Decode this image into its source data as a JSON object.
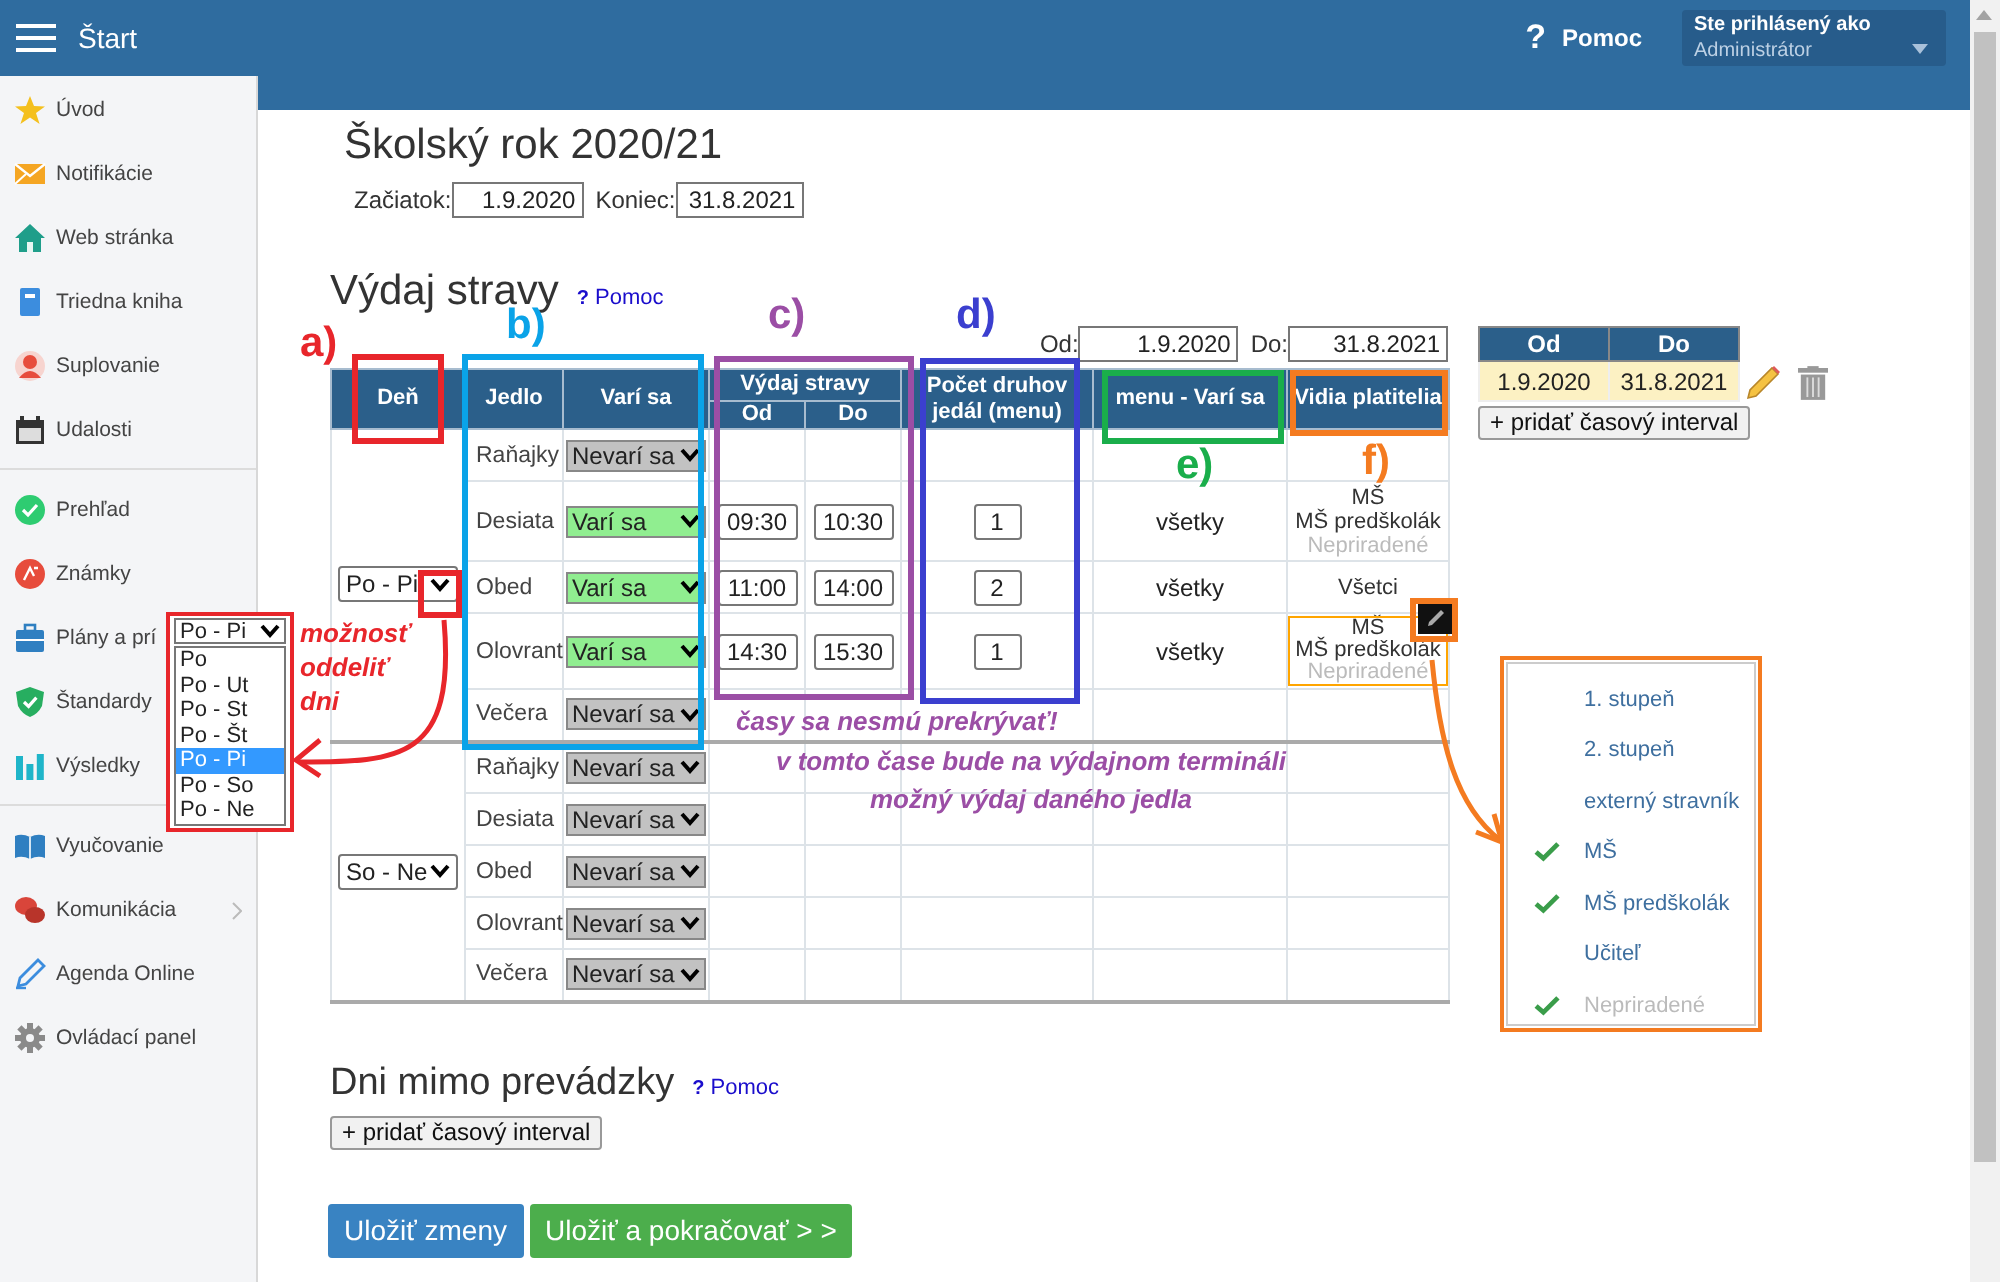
{
  "header": {
    "title": "Štart",
    "help_icon": "?",
    "help": "Pomoc",
    "user_label": "Ste prihlásený ako",
    "user_role": "Administrátor"
  },
  "sidebar": {
    "groups": [
      [
        {
          "label": "Úvod",
          "submenu": false
        },
        {
          "label": "Notifikácie",
          "submenu": false
        },
        {
          "label": "Web stránka",
          "submenu": false
        },
        {
          "label": "Triedna kniha",
          "submenu": false
        },
        {
          "label": "Suplovanie",
          "submenu": false
        },
        {
          "label": "Udalosti",
          "submenu": false
        }
      ],
      [
        {
          "label": "Prehľad",
          "submenu": false
        },
        {
          "label": "Známky",
          "submenu": false
        },
        {
          "label": "Plány a prí",
          "submenu": false
        },
        {
          "label": "Štandardy",
          "submenu": false
        },
        {
          "label": "Výsledky",
          "submenu": false
        }
      ],
      [
        {
          "label": "Vyučovanie",
          "submenu": false
        },
        {
          "label": "Komunikácia",
          "submenu": true
        },
        {
          "label": "Agenda Online",
          "submenu": false
        },
        {
          "label": "Ovládací panel",
          "submenu": false
        }
      ]
    ]
  },
  "school_year": {
    "title": "Školský rok 2020/21",
    "start_label": "Začiatok:",
    "start": "1.9.2020",
    "end_label": "Koniec:",
    "end": "31.8.2021"
  },
  "meal_issue": {
    "title": "Výdaj stravy",
    "help_icon": "?",
    "help": "Pomoc",
    "from_label": "Od:",
    "from": "1.9.2020",
    "to_label": "Do:",
    "to": "31.8.2021",
    "columns": {
      "day": "Deň",
      "meal": "Jedlo",
      "cooking": "Varí sa",
      "issue": "Výdaj stravy",
      "issue_from": "Od",
      "issue_to": "Do",
      "count": "Počet druhov jedál (menu)",
      "menu": "menu - Varí sa",
      "visible": "Vidia platitelia"
    },
    "groups": [
      {
        "days": "Po - Pi",
        "meals": [
          {
            "name": "Raňajky",
            "cooking": false,
            "status": "Nevarí sa",
            "hovered": false
          },
          {
            "name": "Desiata",
            "cooking": true,
            "status": "Varí sa",
            "from": "09:30",
            "to": "10:30",
            "count": "1",
            "menu": "všetky",
            "visible_to": [
              {
                "text": "MŠ",
                "muted": false
              },
              {
                "text": "MŠ predškolák",
                "muted": false
              },
              {
                "text": "Nepriradené",
                "muted": true
              }
            ],
            "hovered": false
          },
          {
            "name": "Obed",
            "cooking": true,
            "status": "Varí sa",
            "from": "11:00",
            "to": "14:00",
            "count": "2",
            "menu": "všetky",
            "visible_to": [
              {
                "text": "Všetci",
                "muted": false
              }
            ],
            "hovered": false
          },
          {
            "name": "Olovrant",
            "cooking": true,
            "status": "Varí sa",
            "from": "14:30",
            "to": "15:30",
            "count": "1",
            "menu": "všetky",
            "visible_to": [
              {
                "text": "MŠ",
                "muted": false
              },
              {
                "text": "MŠ predškolák",
                "muted": false
              },
              {
                "text": "Nepriradené",
                "muted": true
              }
            ],
            "hovered": true
          },
          {
            "name": "Večera",
            "cooking": false,
            "status": "Nevarí sa",
            "hovered": false
          }
        ]
      },
      {
        "days": "So - Ne",
        "meals": [
          {
            "name": "Raňajky",
            "cooking": false,
            "status": "Nevarí sa",
            "hovered": false
          },
          {
            "name": "Desiata",
            "cooking": false,
            "status": "Nevarí sa",
            "hovered": false
          },
          {
            "name": "Obed",
            "cooking": false,
            "status": "Nevarí sa",
            "hovered": false
          },
          {
            "name": "Olovrant",
            "cooking": false,
            "status": "Nevarí sa",
            "hovered": false
          },
          {
            "name": "Večera",
            "cooking": false,
            "status": "Nevarí sa",
            "hovered": false
          }
        ]
      }
    ]
  },
  "intervals": {
    "columns": [
      "Od",
      "Do"
    ],
    "rows": [
      {
        "from": "1.9.2020",
        "to": "31.8.2021"
      }
    ],
    "add_button": "+ pridať časový interval"
  },
  "closed_days": {
    "title": "Dni mimo prevádzky",
    "help_icon": "?",
    "help": "Pomoc",
    "add_button": "+ pridať časový interval"
  },
  "buttons": [
    {
      "label": "Uložiť zmeny",
      "kind": "primary"
    },
    {
      "label": "Uložiť a pokračovať > >",
      "kind": "success"
    }
  ],
  "day_dropdown": {
    "value": "Po - Pi",
    "options": [
      {
        "label": "Po",
        "selected": false
      },
      {
        "label": "Po - Ut",
        "selected": false
      },
      {
        "label": "Po - St",
        "selected": false
      },
      {
        "label": "Po - Št",
        "selected": false
      },
      {
        "label": "Po - Pi",
        "selected": true
      },
      {
        "label": "Po - So",
        "selected": false
      },
      {
        "label": "Po - Ne",
        "selected": false
      }
    ]
  },
  "group_picker": {
    "items": [
      {
        "label": "1. stupeň",
        "checked": false,
        "muted": false
      },
      {
        "label": "2. stupeň",
        "checked": false,
        "muted": false
      },
      {
        "label": "externý stravník",
        "checked": false,
        "muted": false
      },
      {
        "label": "MŠ",
        "checked": true,
        "muted": false
      },
      {
        "label": "MŠ predškolák",
        "checked": true,
        "muted": false
      },
      {
        "label": "Učiteľ",
        "checked": false,
        "muted": false
      },
      {
        "label": "Nepriradené",
        "checked": true,
        "muted": true
      }
    ]
  },
  "annotations": {
    "letters": [
      {
        "text": "a)",
        "color": "#e8262b"
      },
      {
        "text": "b)",
        "color": "#0aa3e8"
      },
      {
        "text": "c)",
        "color": "#9b4ea5"
      },
      {
        "text": "d)",
        "color": "#3b3fcf"
      },
      {
        "text": "e)",
        "color": "#1aae4b"
      },
      {
        "text": "f)",
        "color": "#f47b20"
      }
    ],
    "notes": [
      {
        "text": "možnosť oddeliť dni",
        "color": "#e8262b"
      },
      {
        "text": "časy sa nesmú prekrývať!",
        "color": "#9b4ea5"
      },
      {
        "text": "v tomto čase bude na výdajnom termináli možný výdaj daného jedla",
        "color": "#9b4ea5"
      }
    ]
  }
}
